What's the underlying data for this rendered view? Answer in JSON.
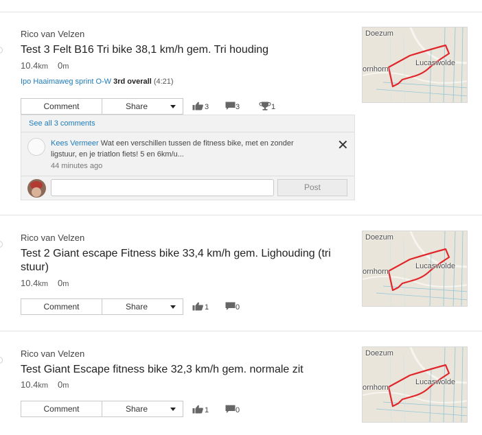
{
  "activities": [
    {
      "athlete": "Rico van Velzen",
      "title": "Test 3 Felt B16 Tri bike 38,1 km/h gem. Tri houding",
      "distance": "10.4",
      "distance_unit": "km",
      "elevation": "0",
      "elevation_unit": "m",
      "segment": {
        "name": "Ipo Haaimaweg sprint O-W",
        "rank": "3rd overall",
        "time": "(4:21)"
      },
      "comment_label": "Comment",
      "share_label": "Share",
      "kudos_count": "3",
      "comment_count": "3",
      "achievement_count": "1",
      "map_labels": {
        "town_top": "Doezum",
        "town_left": "ornhorn",
        "town_right": "Lucaswolde"
      }
    },
    {
      "athlete": "Rico van Velzen",
      "title": "Test 2 Giant escape Fitness bike 33,4 km/h gem. Lighouding (tri stuur)",
      "distance": "10.4",
      "distance_unit": "km",
      "elevation": "0",
      "elevation_unit": "m",
      "comment_label": "Comment",
      "share_label": "Share",
      "kudos_count": "1",
      "comment_count": "0",
      "map_labels": {
        "town_top": "Doezum",
        "town_left": "ornhorn",
        "town_right": "Lucaswolde"
      }
    },
    {
      "athlete": "Rico van Velzen",
      "title": "Test Giant Escape fitness bike 32,3 km/h gem. normale zit",
      "distance": "10.4",
      "distance_unit": "km",
      "elevation": "0",
      "elevation_unit": "m",
      "comment_label": "Comment",
      "share_label": "Share",
      "kudos_count": "1",
      "comment_count": "0",
      "map_labels": {
        "town_top": "Doezum",
        "town_left": "ornhorn",
        "town_right": "Lucaswolde"
      }
    }
  ],
  "comments_panel": {
    "see_all": "See all 3 comments",
    "comment": {
      "author": "Kees Vermeer",
      "text": "Wat een verschillen tussen de fitness bike, met en zonder ligstuur, en je triatlon fiets! 5 en 6km/u...",
      "time": "44 minutes ago"
    },
    "input_placeholder": "",
    "post_label": "Post"
  },
  "colors": {
    "link": "#1d7bb8",
    "route": "#e0262b",
    "map_bg": "#e9e5da"
  },
  "icons": [
    "thumbs-up-icon",
    "comment-bubble-icon",
    "trophy-icon",
    "close-icon",
    "caret-down-icon"
  ]
}
